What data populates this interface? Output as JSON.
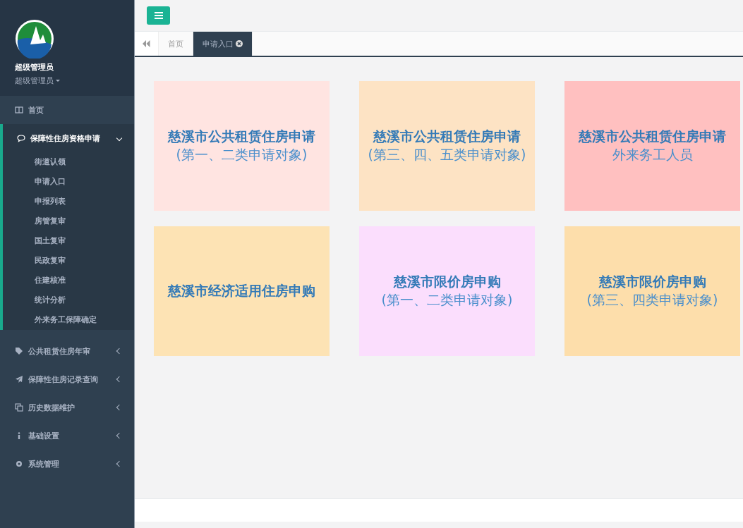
{
  "profile": {
    "name": "超级管理员",
    "role": "超级管理员"
  },
  "menu": [
    {
      "label": "首页",
      "expanded": false,
      "has_children": false
    },
    {
      "label": "保障性住房资格申请",
      "expanded": true,
      "has_children": true,
      "children": [
        {
          "label": "街道认领"
        },
        {
          "label": "申请入口"
        },
        {
          "label": "申报列表"
        },
        {
          "label": "房管复审"
        },
        {
          "label": "国土复审"
        },
        {
          "label": "民政复审"
        },
        {
          "label": "住建核准"
        },
        {
          "label": "统计分析"
        },
        {
          "label": "外来务工保障确定"
        }
      ]
    },
    {
      "label": "公共租赁住房年审",
      "expanded": false,
      "has_children": true
    },
    {
      "label": "保障性住房记录查询",
      "expanded": false,
      "has_children": true
    },
    {
      "label": "历史数据维护",
      "expanded": false,
      "has_children": true
    },
    {
      "label": "基础设置",
      "expanded": false,
      "has_children": true
    },
    {
      "label": "系统管理",
      "expanded": false,
      "has_children": true
    }
  ],
  "tabs": [
    {
      "label": "首页",
      "selected": false,
      "closable": false
    },
    {
      "label": "申请入口",
      "selected": true,
      "closable": true
    }
  ],
  "tiles": [
    {
      "title": "慈溪市公共租赁住房申请",
      "subtitle": "(第一、二类申请对象)",
      "color": "#ffe4e1"
    },
    {
      "title": "慈溪市公共租赁住房申请",
      "subtitle": "(第三、四、五类申请对象)",
      "color": "#fde3c4"
    },
    {
      "title": "慈溪市公共租赁住房申请",
      "subtitle": "外来务工人员",
      "color": "#ffc0c0"
    },
    {
      "title": "慈溪市经济适用住房申购",
      "color": "#fde3b4"
    },
    {
      "title": "慈溪市限价房申购",
      "subtitle": "(第一、二类申请对象)",
      "color": "#fbdefd"
    },
    {
      "title": "慈溪市限价房申购",
      "subtitle": "(第三、四类申请对象)",
      "color": "#fddeab"
    }
  ]
}
